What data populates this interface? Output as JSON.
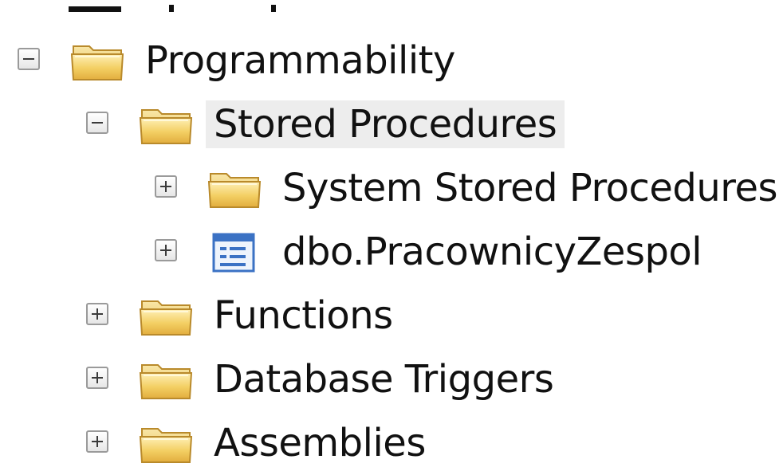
{
  "tree": {
    "nodes": [
      {
        "key": "programmability",
        "label": "Programmability",
        "expand_state": "collapse",
        "icon": "folder-icon"
      },
      {
        "key": "stored-procedures",
        "label": "Stored Procedures",
        "expand_state": "collapse",
        "icon": "folder-icon",
        "selected": true
      },
      {
        "key": "system-stored-procedures",
        "label": "System Stored Procedures",
        "expand_state": "expand",
        "icon": "folder-icon"
      },
      {
        "key": "dbo-pracownicyzespol",
        "label": "dbo.PracownicyZespol",
        "expand_state": "expand",
        "icon": "stored-procedure-icon"
      },
      {
        "key": "functions",
        "label": "Functions",
        "expand_state": "expand",
        "icon": "folder-icon"
      },
      {
        "key": "database-triggers",
        "label": "Database Triggers",
        "expand_state": "expand",
        "icon": "folder-icon"
      },
      {
        "key": "assemblies",
        "label": "Assemblies",
        "expand_state": "expand",
        "icon": "folder-icon"
      }
    ]
  },
  "colors": {
    "selection_background": "#ededed",
    "folder_fill": "#f3cf63",
    "procedure_icon": "#3b72c4"
  }
}
